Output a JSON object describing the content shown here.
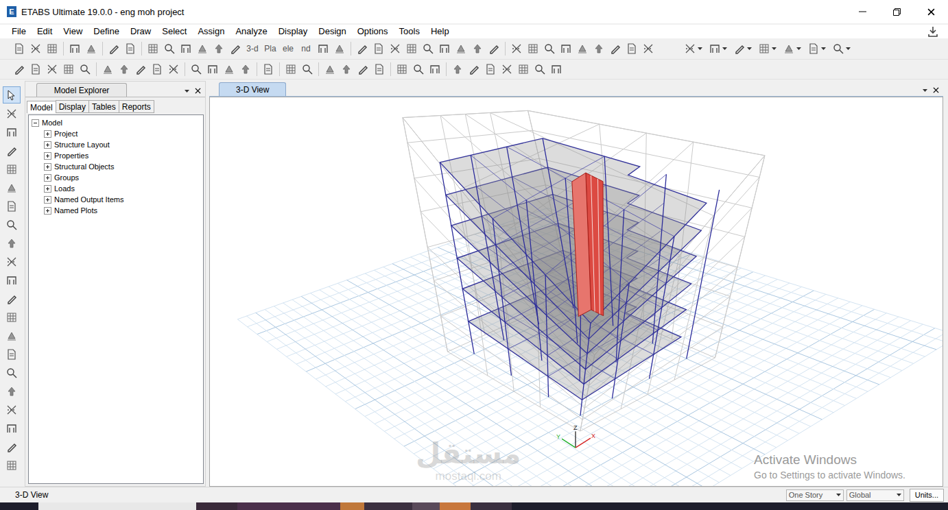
{
  "window": {
    "logo": "E",
    "title": "ETABS Ultimate 19.0.0 - eng moh project"
  },
  "menu": [
    "File",
    "Edit",
    "View",
    "Define",
    "Draw",
    "Select",
    "Assign",
    "Analyze",
    "Display",
    "Design",
    "Options",
    "Tools",
    "Help"
  ],
  "toolbar_texts": [
    "3-d",
    "Pla",
    "ele",
    "nd"
  ],
  "pointer_tool": {
    "selected": true
  },
  "explorer": {
    "title": "Model Explorer",
    "tabs": [
      {
        "label": "Model",
        "selected": true
      },
      {
        "label": "Display",
        "selected": false
      },
      {
        "label": "Tables",
        "selected": false
      },
      {
        "label": "Reports",
        "selected": false
      }
    ],
    "tree": {
      "label": "Model",
      "expanded": true,
      "children": [
        {
          "label": "Project",
          "expanded": false
        },
        {
          "label": "Structure Layout",
          "expanded": false
        },
        {
          "label": "Properties",
          "expanded": false
        },
        {
          "label": "Structural Objects",
          "expanded": false
        },
        {
          "label": "Groups",
          "expanded": false
        },
        {
          "label": "Loads",
          "expanded": false
        },
        {
          "label": "Named Output Items",
          "expanded": false
        },
        {
          "label": "Named Plots",
          "expanded": false
        }
      ]
    }
  },
  "view": {
    "tabs": [
      {
        "label": "3-D View",
        "selected": true
      }
    ],
    "axes": {
      "x": "X",
      "y": "Y",
      "z": "Z"
    }
  },
  "watermarks": {
    "activate_title": "Activate Windows",
    "activate_hint": "Go to Settings to activate Windows.",
    "brand": "مستقل",
    "brand_url": "mostaql.com"
  },
  "status_bar": {
    "text": "3-D View",
    "story": "One Story",
    "coords": "Global",
    "units_button": "Units..."
  }
}
